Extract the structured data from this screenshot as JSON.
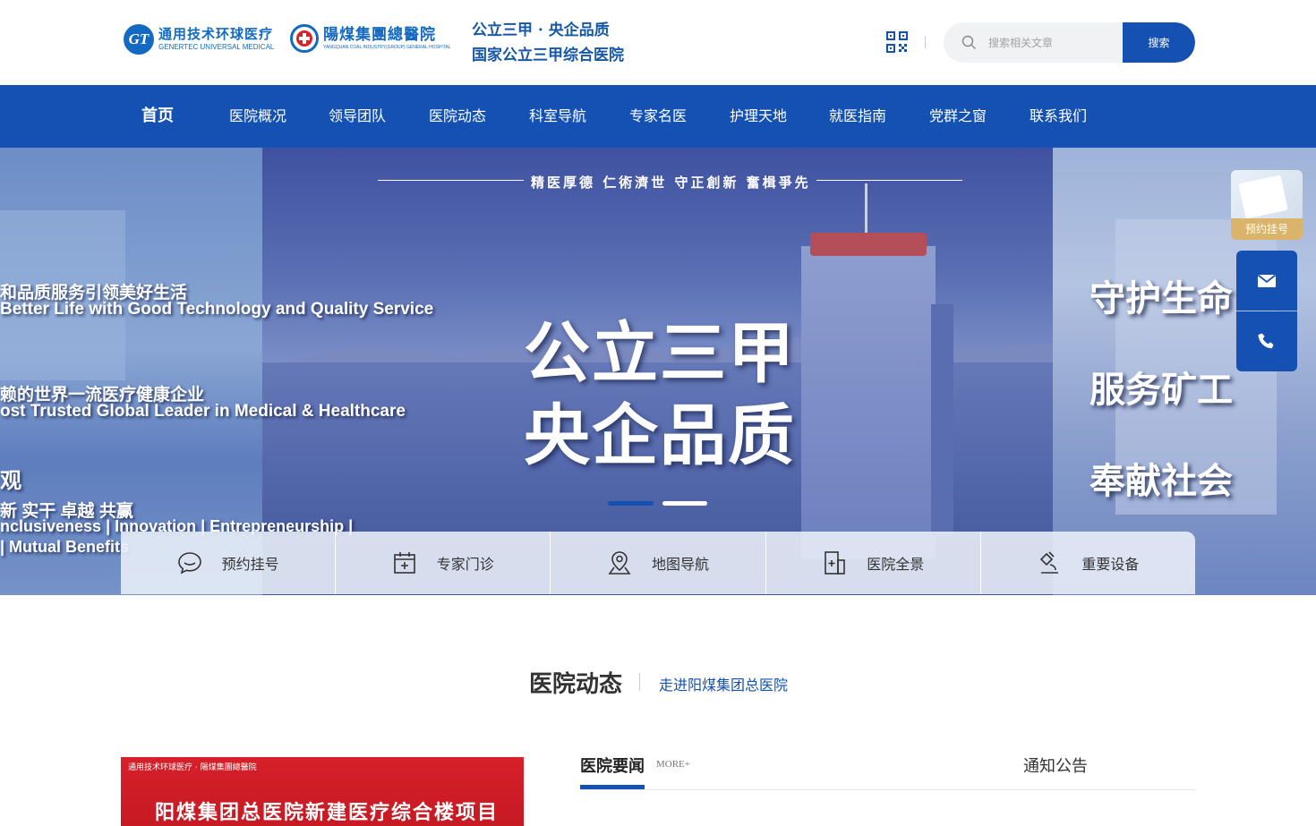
{
  "header": {
    "genertec_logo": {
      "mark": "GT",
      "cn": "通用技术环球医疗",
      "en": "GENERTEC UNIVERSAL MEDICAL"
    },
    "yangmei_logo": {
      "cn": "陽煤集團總醫院",
      "en": "YANGQUAN COAL INDUSTRY(GROUP) GENERAL HOSPITAL"
    },
    "slogan_line1": "公立三甲 · 央企品质",
    "slogan_line2": "国家公立三甲综合医院",
    "search": {
      "placeholder": "搜索相关文章",
      "value": "",
      "button_label": "搜索"
    }
  },
  "nav": {
    "items": [
      {
        "label": "首页",
        "active": true
      },
      {
        "label": "医院概况"
      },
      {
        "label": "领导团队"
      },
      {
        "label": "医院动态"
      },
      {
        "label": "科室导航"
      },
      {
        "label": "专家名医"
      },
      {
        "label": "护理天地"
      },
      {
        "label": "就医指南"
      },
      {
        "label": "党群之窗"
      },
      {
        "label": "联系我们"
      }
    ]
  },
  "banner": {
    "motto": "精医厚德 仁術濟世 守正創新 奮楫爭先",
    "headline1": "公立三甲",
    "headline2": "央企品质",
    "left_texts": [
      "和品质服务引领美好生活",
      "Better Life with Good Technology and Quality Service",
      "赖的世界一流医疗健康企业",
      "ost Trusted Global Leader in Medical & Healthcare",
      "观",
      "新 实干 卓越 共赢",
      "nclusiveness | Innovation | Entrepreneurship |",
      "| Mutual Benefits"
    ],
    "right_texts": [
      "守护生命",
      "服务矿工",
      "奉献社会"
    ],
    "active_slide": 1,
    "slide_count": 2
  },
  "quick_links": [
    {
      "label": "预约挂号",
      "icon": "chat-bubble-icon"
    },
    {
      "label": "专家门诊",
      "icon": "calendar-plus-icon"
    },
    {
      "label": "地图导航",
      "icon": "map-pin-icon"
    },
    {
      "label": "医院全景",
      "icon": "building-icon"
    },
    {
      "label": "重要设备",
      "icon": "microscope-icon"
    }
  ],
  "float_bar": {
    "appointment_label": "预约挂号",
    "mail_icon": "mail-icon",
    "phone_icon": "phone-icon"
  },
  "section": {
    "title": "医院动态",
    "subtitle": "走进阳煤集团总医院",
    "news_image": {
      "logos": "通用技术环球医疗 · 陽煤集團總醫院",
      "title": "阳煤集团总医院新建医疗综合楼项目"
    },
    "tabs": {
      "news": "医院要闻",
      "more": "MORE+",
      "notice": "通知公告"
    }
  },
  "colors": {
    "primary": "#1451b2",
    "accent_gold": "#d9b46a",
    "banner_red": "#d6202a"
  }
}
